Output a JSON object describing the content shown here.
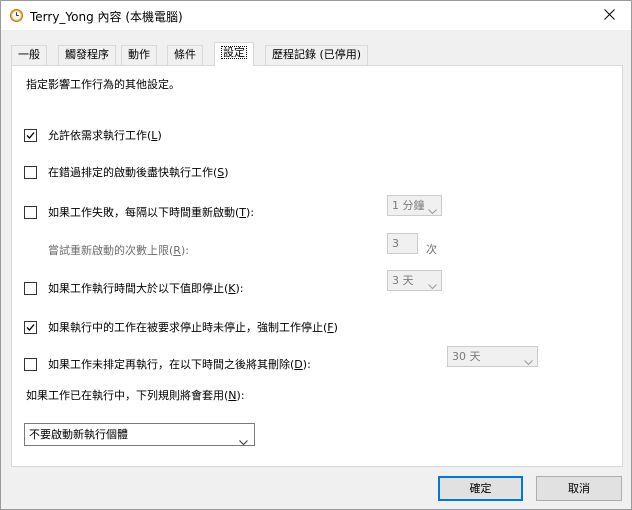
{
  "window": {
    "title": "Terry_Yong 內容 (本機電腦)",
    "icon": "clock-icon"
  },
  "tabs": [
    {
      "label": "一般",
      "active": false
    },
    {
      "label": "觸發程序",
      "active": false
    },
    {
      "label": "動作",
      "active": false
    },
    {
      "label": "條件",
      "active": false
    },
    {
      "label": "設定",
      "active": true
    },
    {
      "label": "歷程記錄 (已停用)",
      "active": false
    }
  ],
  "settings": {
    "description": "指定影響工作行為的其他設定。",
    "allow_on_demand": {
      "text": "允許依需求執行工作(",
      "key": "L",
      "end": ")",
      "checked": true
    },
    "run_asap": {
      "text": "在錯過排定的啟動後盡快執行工作(",
      "key": "S",
      "end": ")",
      "checked": false
    },
    "restart_on_fail": {
      "text": "如果工作失敗，每隔以下時間重新啟動(",
      "key": "T",
      "end": "):",
      "checked": false,
      "interval": "1 分鐘"
    },
    "restart_attempts": {
      "text": "嘗試重新啟動的次數上限(",
      "key": "R",
      "end": "):",
      "value": "3",
      "unit": "次"
    },
    "stop_if_longer": {
      "text": "如果工作執行時間大於以下值即停止(",
      "key": "K",
      "end": "):",
      "checked": false,
      "duration": "3 天"
    },
    "force_stop": {
      "text": "如果執行中的工作在被要求停止時未停止，強制工作停止(",
      "key": "F",
      "end": ")",
      "checked": true
    },
    "delete_if_not_scheduled": {
      "text": "如果工作未排定再執行，在以下時間之後將其刪除(",
      "key": "D",
      "end": "):",
      "checked": false,
      "after": "30 天"
    },
    "running_rule": {
      "text": "如果工作已在執行中，下列規則將會套用(",
      "key": "N",
      "end": "):",
      "selected": "不要啟動新執行個體"
    }
  },
  "buttons": {
    "ok": "確定",
    "cancel": "取消"
  }
}
